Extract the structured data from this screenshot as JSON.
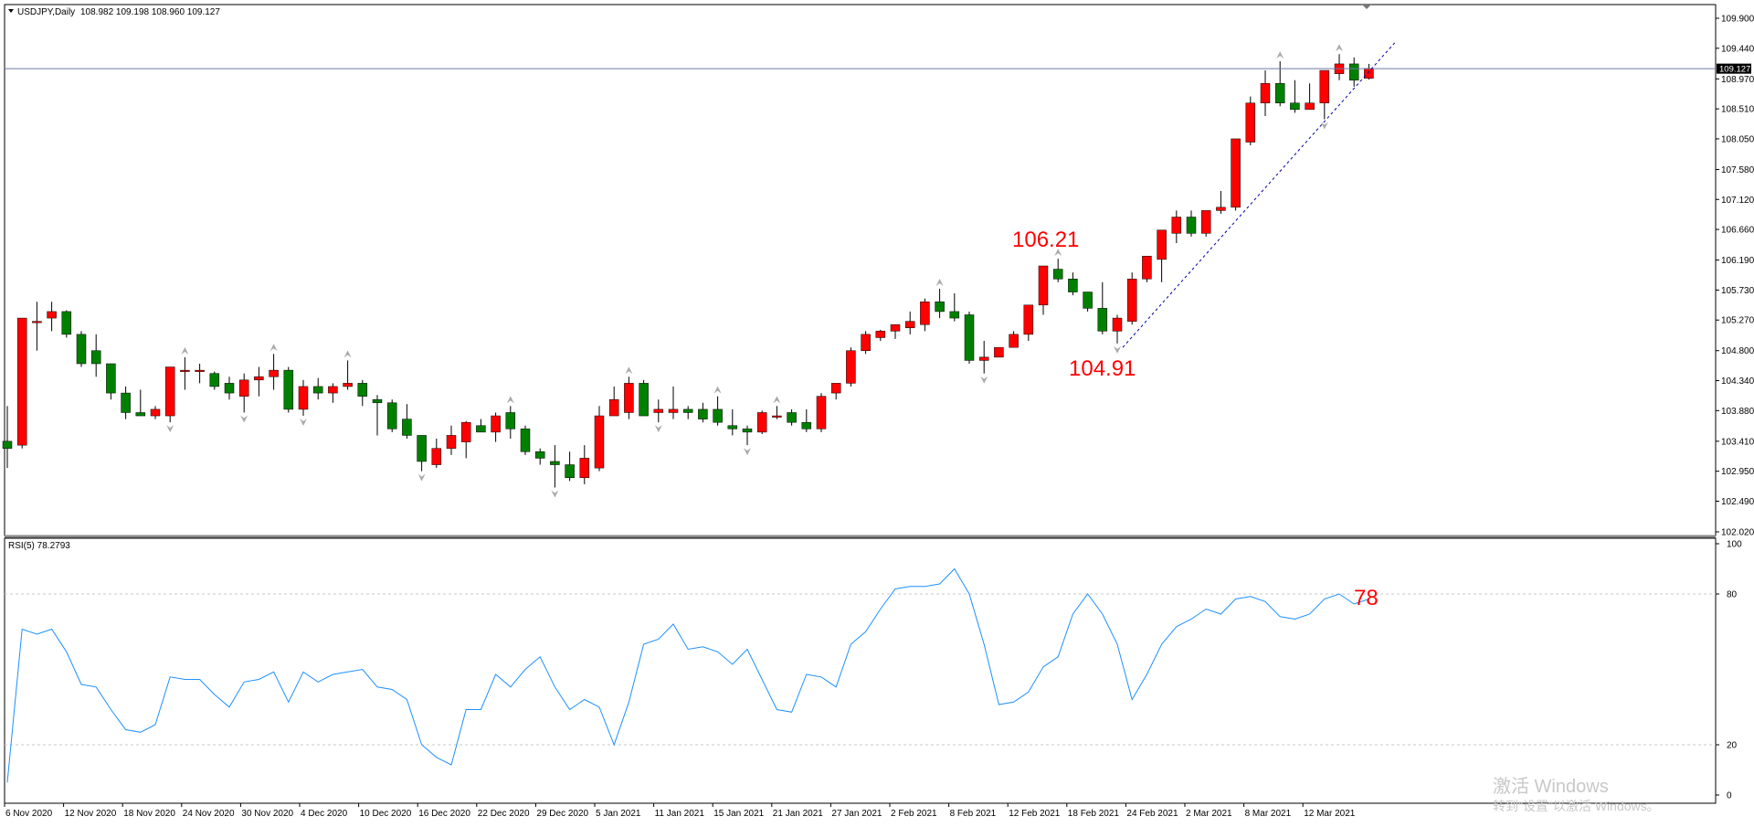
{
  "header": {
    "symbol_timeframe": "USDJPY,Daily",
    "ohlc": "108.982 109.198 108.960 109.127"
  },
  "price_axis": {
    "current_price_label": "109.127",
    "current_price": 109.127,
    "ticks": [
      "109.900",
      "109.440",
      "108.970",
      "108.510",
      "108.050",
      "107.580",
      "107.120",
      "106.660",
      "106.190",
      "105.730",
      "105.270",
      "104.800",
      "104.340",
      "103.880",
      "103.410",
      "102.950",
      "102.490",
      "102.020"
    ]
  },
  "rsi": {
    "label": "RSI(5) 78.2793",
    "ticks": [
      "100",
      "80",
      "20",
      "0"
    ],
    "levels": [
      80,
      20
    ]
  },
  "time_axis": {
    "labels": [
      "6 Nov 2020",
      "12 Nov 2020",
      "18 Nov 2020",
      "24 Nov 2020",
      "30 Nov 2020",
      "4 Dec 2020",
      "10 Dec 2020",
      "16 Dec 2020",
      "22 Dec 2020",
      "29 Dec 2020",
      "5 Jan 2021",
      "11 Jan 2021",
      "15 Jan 2021",
      "21 Jan 2021",
      "27 Jan 2021",
      "2 Feb 2021",
      "8 Feb 2021",
      "12 Feb 2021",
      "18 Feb 2021",
      "24 Feb 2021",
      "2 Mar 2021",
      "8 Mar 2021",
      "12 Mar 2021"
    ]
  },
  "annotations": {
    "high_label": "106.21",
    "low_label": "104.91",
    "rsi_label": "78"
  },
  "watermark": {
    "line1": "激活 Windows",
    "line2": "转到\"设置\"以激活 Windows。"
  },
  "colors": {
    "bull": "#008000",
    "bear": "#ff0000",
    "rsi_line": "#1e90ff",
    "annotation": "#ff0000",
    "trendline": "#0000aa"
  },
  "chart_data": [
    {
      "type": "candlestick",
      "title": "USDJPY,Daily",
      "ylim": [
        102.02,
        109.9
      ],
      "note_bull_color": "green = close below open in this chart's scheme is shown in red",
      "candles": [
        {
          "o": 103.41,
          "h": 103.95,
          "l": 103.0,
          "c": 103.3
        },
        {
          "o": 103.35,
          "h": 105.3,
          "l": 103.3,
          "c": 105.3
        },
        {
          "o": 105.25,
          "h": 105.55,
          "l": 104.8,
          "c": 105.25
        },
        {
          "o": 105.3,
          "h": 105.55,
          "l": 105.1,
          "c": 105.4
        },
        {
          "o": 105.4,
          "h": 105.42,
          "l": 105.0,
          "c": 105.05
        },
        {
          "o": 105.05,
          "h": 105.1,
          "l": 104.55,
          "c": 104.6
        },
        {
          "o": 104.8,
          "h": 105.05,
          "l": 104.4,
          "c": 104.6
        },
        {
          "o": 104.6,
          "h": 104.6,
          "l": 104.05,
          "c": 104.15
        },
        {
          "o": 104.15,
          "h": 104.25,
          "l": 103.75,
          "c": 103.85
        },
        {
          "o": 103.85,
          "h": 104.2,
          "l": 103.8,
          "c": 103.8
        },
        {
          "o": 103.8,
          "h": 103.95,
          "l": 103.75,
          "c": 103.9
        },
        {
          "o": 103.8,
          "h": 104.55,
          "l": 103.7,
          "c": 104.55
        },
        {
          "o": 104.5,
          "h": 104.7,
          "l": 104.2,
          "c": 104.5
        },
        {
          "o": 104.5,
          "h": 104.6,
          "l": 104.3,
          "c": 104.5
        },
        {
          "o": 104.45,
          "h": 104.48,
          "l": 104.2,
          "c": 104.25
        },
        {
          "o": 104.3,
          "h": 104.4,
          "l": 104.05,
          "c": 104.15
        },
        {
          "o": 104.1,
          "h": 104.45,
          "l": 103.85,
          "c": 104.35
        },
        {
          "o": 104.35,
          "h": 104.55,
          "l": 104.1,
          "c": 104.4
        },
        {
          "o": 104.4,
          "h": 104.75,
          "l": 104.2,
          "c": 104.5
        },
        {
          "o": 104.5,
          "h": 104.55,
          "l": 103.85,
          "c": 103.9
        },
        {
          "o": 103.9,
          "h": 104.35,
          "l": 103.8,
          "c": 104.25
        },
        {
          "o": 104.25,
          "h": 104.38,
          "l": 104.05,
          "c": 104.15
        },
        {
          "o": 104.15,
          "h": 104.3,
          "l": 104.0,
          "c": 104.25
        },
        {
          "o": 104.25,
          "h": 104.65,
          "l": 104.2,
          "c": 104.3
        },
        {
          "o": 104.3,
          "h": 104.35,
          "l": 103.95,
          "c": 104.1
        },
        {
          "o": 104.05,
          "h": 104.12,
          "l": 103.5,
          "c": 104.0
        },
        {
          "o": 104.0,
          "h": 104.05,
          "l": 103.55,
          "c": 103.6
        },
        {
          "o": 103.75,
          "h": 103.98,
          "l": 103.45,
          "c": 103.5
        },
        {
          "o": 103.5,
          "h": 103.5,
          "l": 102.95,
          "c": 103.1
        },
        {
          "o": 103.05,
          "h": 103.45,
          "l": 103.0,
          "c": 103.3
        },
        {
          "o": 103.3,
          "h": 103.65,
          "l": 103.2,
          "c": 103.5
        },
        {
          "o": 103.4,
          "h": 103.72,
          "l": 103.15,
          "c": 103.7
        },
        {
          "o": 103.65,
          "h": 103.75,
          "l": 103.55,
          "c": 103.55
        },
        {
          "o": 103.55,
          "h": 103.85,
          "l": 103.4,
          "c": 103.8
        },
        {
          "o": 103.85,
          "h": 103.95,
          "l": 103.45,
          "c": 103.6
        },
        {
          "o": 103.6,
          "h": 103.65,
          "l": 103.2,
          "c": 103.25
        },
        {
          "o": 103.25,
          "h": 103.3,
          "l": 103.05,
          "c": 103.15
        },
        {
          "o": 103.1,
          "h": 103.35,
          "l": 102.7,
          "c": 103.05
        },
        {
          "o": 103.05,
          "h": 103.25,
          "l": 102.8,
          "c": 102.85
        },
        {
          "o": 102.85,
          "h": 103.35,
          "l": 102.75,
          "c": 103.15
        },
        {
          "o": 103.0,
          "h": 103.95,
          "l": 102.95,
          "c": 103.8
        },
        {
          "o": 103.8,
          "h": 104.25,
          "l": 103.8,
          "c": 104.05
        },
        {
          "o": 103.85,
          "h": 104.4,
          "l": 103.75,
          "c": 104.3
        },
        {
          "o": 104.3,
          "h": 104.35,
          "l": 103.8,
          "c": 103.8
        },
        {
          "o": 103.85,
          "h": 104.05,
          "l": 103.7,
          "c": 103.9
        },
        {
          "o": 103.85,
          "h": 104.25,
          "l": 103.75,
          "c": 103.9
        },
        {
          "o": 103.9,
          "h": 103.95,
          "l": 103.75,
          "c": 103.85
        },
        {
          "o": 103.9,
          "h": 104.0,
          "l": 103.7,
          "c": 103.75
        },
        {
          "o": 103.9,
          "h": 104.1,
          "l": 103.65,
          "c": 103.7
        },
        {
          "o": 103.65,
          "h": 103.9,
          "l": 103.5,
          "c": 103.6
        },
        {
          "o": 103.6,
          "h": 103.65,
          "l": 103.35,
          "c": 103.55
        },
        {
          "o": 103.55,
          "h": 103.88,
          "l": 103.52,
          "c": 103.85
        },
        {
          "o": 103.8,
          "h": 103.95,
          "l": 103.75,
          "c": 103.8
        },
        {
          "o": 103.85,
          "h": 103.9,
          "l": 103.65,
          "c": 103.7
        },
        {
          "o": 103.7,
          "h": 103.9,
          "l": 103.55,
          "c": 103.6
        },
        {
          "o": 103.6,
          "h": 104.15,
          "l": 103.55,
          "c": 104.1
        },
        {
          "o": 104.15,
          "h": 104.3,
          "l": 104.05,
          "c": 104.3
        },
        {
          "o": 104.3,
          "h": 104.85,
          "l": 104.25,
          "c": 104.8
        },
        {
          "o": 104.8,
          "h": 105.1,
          "l": 104.75,
          "c": 105.05
        },
        {
          "o": 105.0,
          "h": 105.12,
          "l": 104.95,
          "c": 105.1
        },
        {
          "o": 105.1,
          "h": 105.15,
          "l": 104.98,
          "c": 105.2
        },
        {
          "o": 105.15,
          "h": 105.4,
          "l": 105.05,
          "c": 105.25
        },
        {
          "o": 105.2,
          "h": 105.6,
          "l": 105.1,
          "c": 105.55
        },
        {
          "o": 105.55,
          "h": 105.75,
          "l": 105.3,
          "c": 105.4
        },
        {
          "o": 105.4,
          "h": 105.68,
          "l": 105.25,
          "c": 105.3
        },
        {
          "o": 105.35,
          "h": 105.4,
          "l": 104.6,
          "c": 104.65
        },
        {
          "o": 104.65,
          "h": 104.95,
          "l": 104.45,
          "c": 104.7
        },
        {
          "o": 104.7,
          "h": 104.85,
          "l": 104.7,
          "c": 104.85
        },
        {
          "o": 104.85,
          "h": 105.1,
          "l": 104.85,
          "c": 105.05
        },
        {
          "o": 105.05,
          "h": 105.15,
          "l": 104.95,
          "c": 105.5
        },
        {
          "o": 105.5,
          "h": 106.1,
          "l": 105.35,
          "c": 106.1
        },
        {
          "o": 106.05,
          "h": 106.21,
          "l": 105.85,
          "c": 105.9
        },
        {
          "o": 105.9,
          "h": 106.0,
          "l": 105.65,
          "c": 105.7
        },
        {
          "o": 105.7,
          "h": 105.7,
          "l": 105.4,
          "c": 105.45
        },
        {
          "o": 105.45,
          "h": 105.85,
          "l": 105.05,
          "c": 105.1
        },
        {
          "o": 105.1,
          "h": 105.35,
          "l": 104.91,
          "c": 105.3
        },
        {
          "o": 105.25,
          "h": 106.0,
          "l": 105.2,
          "c": 105.9
        },
        {
          "o": 105.9,
          "h": 106.25,
          "l": 105.85,
          "c": 106.25
        },
        {
          "o": 106.2,
          "h": 106.5,
          "l": 105.85,
          "c": 106.65
        },
        {
          "o": 106.6,
          "h": 106.95,
          "l": 106.45,
          "c": 106.85
        },
        {
          "o": 106.85,
          "h": 106.95,
          "l": 106.55,
          "c": 106.6
        },
        {
          "o": 106.6,
          "h": 106.9,
          "l": 106.55,
          "c": 106.95
        },
        {
          "o": 106.95,
          "h": 107.25,
          "l": 106.9,
          "c": 107.0
        },
        {
          "o": 107.0,
          "h": 108.05,
          "l": 106.95,
          "c": 108.05
        },
        {
          "o": 108.0,
          "h": 108.7,
          "l": 107.95,
          "c": 108.6
        },
        {
          "o": 108.6,
          "h": 109.1,
          "l": 108.4,
          "c": 108.9
        },
        {
          "o": 108.9,
          "h": 109.24,
          "l": 108.55,
          "c": 108.6
        },
        {
          "o": 108.6,
          "h": 108.95,
          "l": 108.45,
          "c": 108.5
        },
        {
          "o": 108.5,
          "h": 108.9,
          "l": 108.5,
          "c": 108.6
        },
        {
          "o": 108.6,
          "h": 109.1,
          "l": 108.35,
          "c": 109.1
        },
        {
          "o": 109.05,
          "h": 109.35,
          "l": 108.95,
          "c": 109.2
        },
        {
          "o": 109.2,
          "h": 109.3,
          "l": 108.85,
          "c": 108.95
        },
        {
          "o": 108.98,
          "h": 109.2,
          "l": 108.96,
          "c": 109.13
        }
      ]
    },
    {
      "type": "line",
      "title": "RSI(5) 78.2793",
      "ylim": [
        0,
        100
      ],
      "series": [
        {
          "name": "RSI(5)",
          "values": [
            5,
            66,
            64,
            66,
            57,
            44,
            43,
            34,
            26,
            25,
            28,
            47,
            46,
            46,
            40,
            35,
            45,
            46,
            49,
            37,
            49,
            45,
            48,
            49,
            50,
            43,
            42,
            38,
            20,
            15,
            12,
            34,
            34,
            48,
            43,
            50,
            55,
            43,
            34,
            38,
            35,
            20,
            37,
            60,
            62,
            68,
            58,
            59,
            57,
            52,
            58,
            46,
            34,
            33,
            48,
            47,
            43,
            60,
            65,
            74,
            82,
            83,
            83,
            84,
            90,
            80,
            60,
            36,
            37,
            41,
            51,
            55,
            72,
            80,
            72,
            60,
            38,
            48,
            60,
            67,
            70,
            74,
            72,
            78,
            79,
            77,
            71,
            70,
            72,
            78,
            80,
            76,
            78
          ]
        }
      ]
    }
  ]
}
